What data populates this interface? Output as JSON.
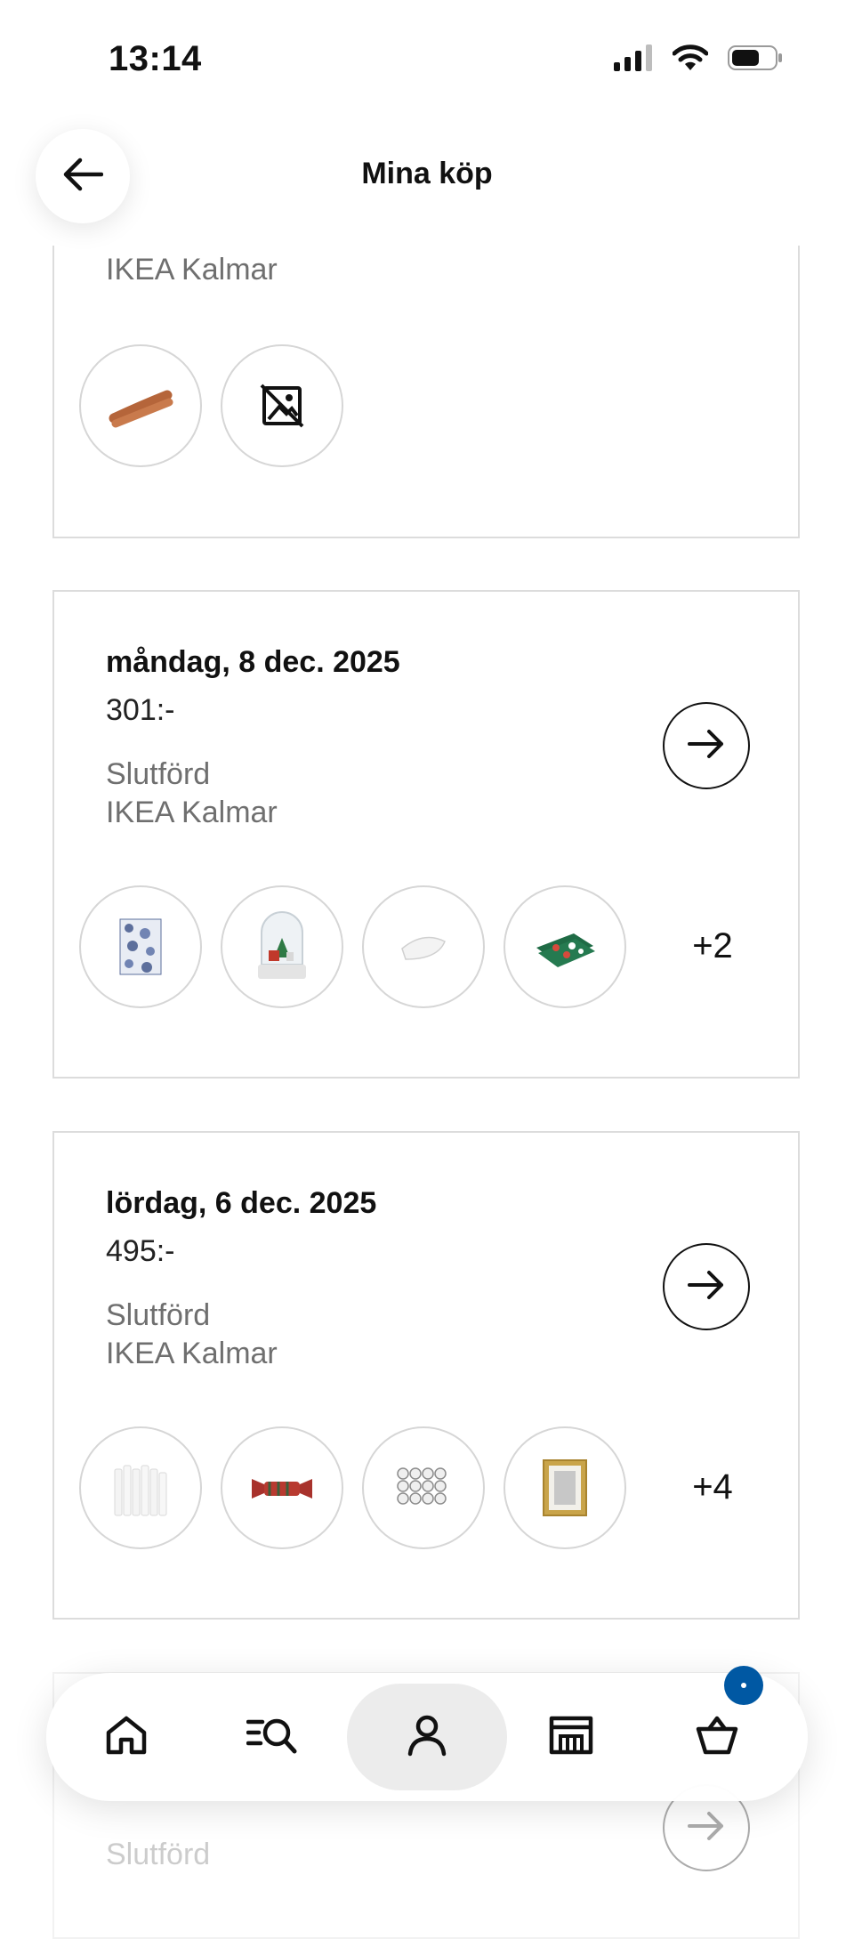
{
  "status_bar": {
    "time": "13:14"
  },
  "header": {
    "title": "Mina köp"
  },
  "orders": [
    {
      "date": "",
      "price": "",
      "status": "",
      "store": "IKEA Kalmar",
      "thumbnails": [
        "hotdog-sausage-thumbnail",
        "no-image-placeholder-icon"
      ],
      "more": ""
    },
    {
      "date": "måndag, 8 dec. 2025",
      "price": "301:-",
      "status": "Slutförd",
      "store": "IKEA Kalmar",
      "thumbnails": [
        "blue-patterned-napkins-thumbnail",
        "snow-globe-thumbnail",
        "white-cushion-thumbnail",
        "green-christmas-napkins-thumbnail"
      ],
      "more": "+2"
    },
    {
      "date": "lördag, 6 dec. 2025",
      "price": "495:-",
      "status": "Slutförd",
      "store": "IKEA Kalmar",
      "thumbnails": [
        "white-candles-thumbnail",
        "christmas-cracker-thumbnail",
        "tealights-thumbnail",
        "gold-frame-thumbnail"
      ],
      "more": "+4"
    },
    {
      "date": "",
      "price": "",
      "status": "Slutförd",
      "store": "",
      "thumbnails": [],
      "more": ""
    }
  ],
  "bottom_nav": {
    "items": [
      {
        "id": "home",
        "icon": "home-icon"
      },
      {
        "id": "search",
        "icon": "search-icon"
      },
      {
        "id": "profile",
        "icon": "profile-icon",
        "active": true
      },
      {
        "id": "store",
        "icon": "store-icon"
      },
      {
        "id": "cart",
        "icon": "cart-icon"
      }
    ],
    "cart_badge_color": "#0058a3"
  },
  "colors": {
    "accent": "#0058a3",
    "text": "#111111",
    "muted": "#6f6f6f",
    "border": "#dcdcdc"
  }
}
